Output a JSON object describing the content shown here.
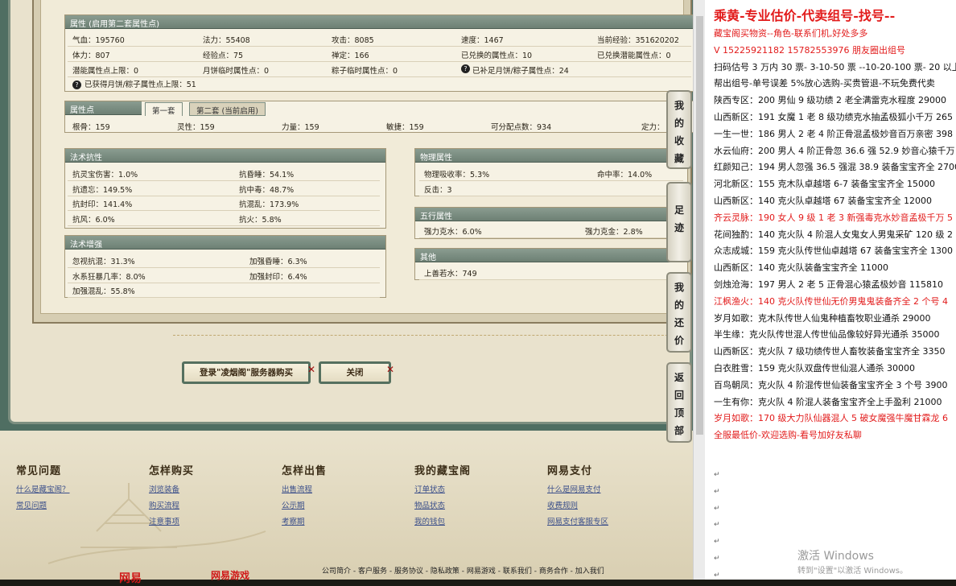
{
  "attr_title": "属性 (启用第二套属性点)",
  "attr_rows": [
    [
      "气血：195760",
      "法力：55408",
      "攻击：8085",
      "速度：1467",
      "当前经验：351620202"
    ],
    [
      "体力：807",
      "经验点：75",
      "禅定：166",
      "已兑换的属性点：10",
      "已兑换潜能属性点：0"
    ],
    [
      "潜能属性点上限：0",
      "月饼临时属性点：0",
      "粽子临时属性点：0",
      "已补足月饼/粽子属性点：24",
      ""
    ]
  ],
  "attr_note": "已获得月饼/粽子属性点上限：51",
  "points_title": "属性点",
  "tab1": "第一套",
  "tab2": "第二套 (当前启用)",
  "points_row": [
    "根骨：159",
    "灵性：159",
    "力量：159",
    "敏捷：159",
    "可分配点数：934",
    "定力："
  ],
  "fk_title": "法术抗性",
  "fk_rows": [
    [
      "抗灵宝伤害：1.0%",
      "抗昏睡：54.1%"
    ],
    [
      "抗遗忘：149.5%",
      "抗中毒：48.7%"
    ],
    [
      "抗封印：141.4%",
      "抗混乱：173.9%"
    ],
    [
      "抗风：6.0%",
      "抗火：5.8%"
    ]
  ],
  "fz_title": "法术增强",
  "fz_rows": [
    [
      "忽视抗混：31.3%",
      "加强昏睡：6.3%"
    ],
    [
      "水系狂暴几率：8.0%",
      "加强封印：6.4%"
    ],
    [
      "加强混乱：55.8%",
      ""
    ]
  ],
  "wl_title": "物理属性",
  "wl_rows": [
    [
      "物理吸收率：5.3%",
      "命中率：14.0%"
    ],
    [
      "反击：3",
      ""
    ]
  ],
  "wx_title": "五行属性",
  "wx_rows": [
    [
      "强力克水：6.0%",
      "强力克金：2.8%"
    ]
  ],
  "qt_title": "其他",
  "qt_rows": [
    [
      "上善若水：749"
    ]
  ],
  "btn_buy": "登录\"凌烟阁\"服务器购买",
  "btn_close": "关闭",
  "footer": {
    "cols": [
      {
        "h": "常见问题",
        "links": [
          "什么是藏宝阁？",
          "常见问题"
        ]
      },
      {
        "h": "怎样购买",
        "links": [
          "浏览装备",
          "购买流程",
          "注意事项"
        ]
      },
      {
        "h": "怎样出售",
        "links": [
          "出售流程",
          "公示期",
          "考察期"
        ]
      },
      {
        "h": "我的藏宝阁",
        "links": [
          "订单状态",
          "物品状态",
          "我的钱包"
        ]
      },
      {
        "h": "网易支付",
        "links": [
          "什么是网易支付",
          "收费规则",
          "网易支付客服专区"
        ]
      }
    ],
    "bottom": "公司简介 - 客户服务 - 服务协议 - 隐私政策 - 网易游戏 - 联系我们 - 商务合作 - 加入我们"
  },
  "side_buttons": [
    "我的收藏",
    "足迹",
    "我的还价",
    "返回顶部"
  ],
  "right": {
    "title": "乘黄-专业估价-代卖组号-找号--",
    "lines": [
      {
        "t": "藏宝阁买物资--角色-联系们机,好处多多",
        "c": "red"
      },
      {
        "t": "V 15225921182   15782553976 朋友圈出组号",
        "c": "red"
      },
      {
        "t": "扫码估号 3 万内 30 票- 3-10-50 票  --10-20-100 票- 20 以上",
        "c": ""
      },
      {
        "t": "帮出组号-单号误差 5%放心选购-买贵管退-不玩免费代卖",
        "c": ""
      },
      {
        "t": "陕西专区：200 男仙 9 级功绩 2 老全满雷克水程度 29000",
        "c": ""
      },
      {
        "t": "山西新区：191 女魔 1 老 8 级功绩克水抽孟极狐小千万 265",
        "c": ""
      },
      {
        "t": "一生一世：186 男人 2 老 4 阶正骨混孟极妙音百万亲密 398",
        "c": ""
      },
      {
        "t": "水云仙府：200 男人 4 阶正骨忽 36.6 强 52.9 妙音心猿千万",
        "c": ""
      },
      {
        "t": "红颜知己：194 男人忽强 36.5 强混 38.9 装备宝宝齐全 2700",
        "c": ""
      },
      {
        "t": "河北新区：155 克木队卓越塔 6-7 装备宝宝齐全 15000",
        "c": ""
      },
      {
        "t": "山西新区：140 克火队卓越塔 67 装备宝宝齐全 12000",
        "c": ""
      },
      {
        "t": "齐云灵脉：190 女人 9 级 1 老 3 新强毒克水妙音孟极千万 5",
        "c": "red"
      },
      {
        "t": "花间独酌：140 克火队 4 阶混人女鬼女人男鬼采矿 120 级 2",
        "c": ""
      },
      {
        "t": "众志成城：159 克火队传世仙卓越塔 67 装备宝宝齐全 1300",
        "c": ""
      },
      {
        "t": "山西新区：140 克火队装备宝宝齐全 11000",
        "c": ""
      },
      {
        "t": "剑烛沧海：197 男人 2 老 5 正骨混心猿孟极妙音 115810",
        "c": ""
      },
      {
        "t": "江枫渔火：140 克火队传世仙无价男鬼鬼装备齐全 2 个号 4",
        "c": "red"
      },
      {
        "t": "岁月如歌：克木队传世人仙鬼种植畜牧职业通杀 29000",
        "c": ""
      },
      {
        "t": "半生缘：克火队传世混人传世仙品像较好异光通杀 35000",
        "c": ""
      },
      {
        "t": "山西新区：克火队 7 级功绩传世人畜牧装备宝宝齐全 3350",
        "c": ""
      },
      {
        "t": "白衣胜雪：159 克火队双盘传世仙混人通杀 30000",
        "c": ""
      },
      {
        "t": "百鸟朝凤：克火队 4 阶混传世仙装备宝宝齐全 3 个号 3900",
        "c": ""
      },
      {
        "t": "一生有你：克火队 4 阶混人装备宝宝齐全上手盈利 21000",
        "c": ""
      },
      {
        "t": "岁月如歌：170 级大力队仙器混人 5 破女魔强牛魔甘霖龙 6",
        "c": "red"
      },
      {
        "t": "全服最低价-欢迎选购-看号加好友私聊",
        "c": "red"
      }
    ],
    "watermark1": "激活 Windows",
    "watermark2": "转到\"设置\"以激活 Windows。"
  }
}
